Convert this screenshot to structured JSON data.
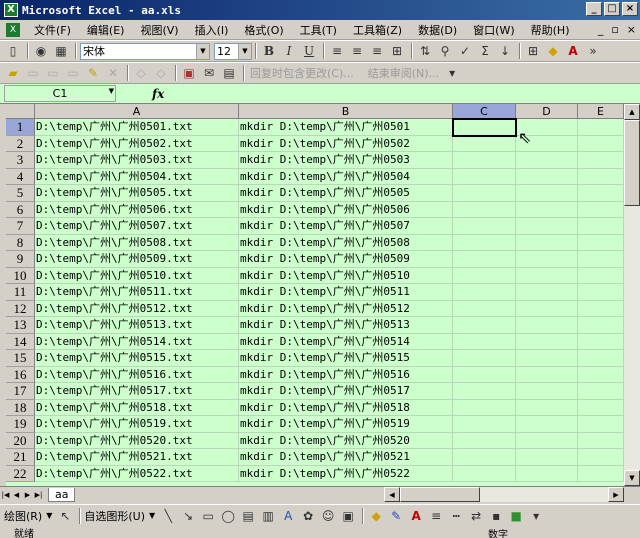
{
  "window": {
    "title": "Microsoft Excel - aa.xls",
    "icon_label": "X",
    "controls": [
      "_",
      "□",
      "×"
    ]
  },
  "menu": {
    "items": [
      "文件(F)",
      "编辑(E)",
      "视图(V)",
      "插入(I)",
      "格式(O)",
      "工具(T)",
      "工具箱(Z)",
      "数据(D)",
      "窗口(W)",
      "帮助(H)"
    ],
    "doc_controls": [
      "_",
      "▫",
      "×"
    ]
  },
  "format_toolbar": {
    "font_name": "宋体",
    "font_size": "12",
    "bold": "B",
    "italic": "I",
    "underline": "U"
  },
  "review_toolbar": {
    "reply_label": "回复时包含更改(C)...",
    "end_review_label": "结束审阅(N)..."
  },
  "formula_bar": {
    "name_box": "C1",
    "fx": "fx",
    "content": ""
  },
  "grid": {
    "columns": [
      "A",
      "B",
      "C",
      "D",
      "E"
    ],
    "active_column": "C",
    "active_cell": "C1",
    "rows": [
      {
        "n": "1",
        "a": "D:\\temp\\广州\\广州0501.txt",
        "b": "mkdir D:\\temp\\广州\\广州0501"
      },
      {
        "n": "2",
        "a": "D:\\temp\\广州\\广州0502.txt",
        "b": "mkdir D:\\temp\\广州\\广州0502"
      },
      {
        "n": "3",
        "a": "D:\\temp\\广州\\广州0503.txt",
        "b": "mkdir D:\\temp\\广州\\广州0503"
      },
      {
        "n": "4",
        "a": "D:\\temp\\广州\\广州0504.txt",
        "b": "mkdir D:\\temp\\广州\\广州0504"
      },
      {
        "n": "5",
        "a": "D:\\temp\\广州\\广州0505.txt",
        "b": "mkdir D:\\temp\\广州\\广州0505"
      },
      {
        "n": "6",
        "a": "D:\\temp\\广州\\广州0506.txt",
        "b": "mkdir D:\\temp\\广州\\广州0506"
      },
      {
        "n": "7",
        "a": "D:\\temp\\广州\\广州0507.txt",
        "b": "mkdir D:\\temp\\广州\\广州0507"
      },
      {
        "n": "8",
        "a": "D:\\temp\\广州\\广州0508.txt",
        "b": "mkdir D:\\temp\\广州\\广州0508"
      },
      {
        "n": "9",
        "a": "D:\\temp\\广州\\广州0509.txt",
        "b": "mkdir D:\\temp\\广州\\广州0509"
      },
      {
        "n": "10",
        "a": "D:\\temp\\广州\\广州0510.txt",
        "b": "mkdir D:\\temp\\广州\\广州0510"
      },
      {
        "n": "11",
        "a": "D:\\temp\\广州\\广州0511.txt",
        "b": "mkdir D:\\temp\\广州\\广州0511"
      },
      {
        "n": "12",
        "a": "D:\\temp\\广州\\广州0512.txt",
        "b": "mkdir D:\\temp\\广州\\广州0512"
      },
      {
        "n": "13",
        "a": "D:\\temp\\广州\\广州0513.txt",
        "b": "mkdir D:\\temp\\广州\\广州0513"
      },
      {
        "n": "14",
        "a": "D:\\temp\\广州\\广州0514.txt",
        "b": "mkdir D:\\temp\\广州\\广州0514"
      },
      {
        "n": "15",
        "a": "D:\\temp\\广州\\广州0515.txt",
        "b": "mkdir D:\\temp\\广州\\广州0515"
      },
      {
        "n": "16",
        "a": "D:\\temp\\广州\\广州0516.txt",
        "b": "mkdir D:\\temp\\广州\\广州0516"
      },
      {
        "n": "17",
        "a": "D:\\temp\\广州\\广州0517.txt",
        "b": "mkdir D:\\temp\\广州\\广州0517"
      },
      {
        "n": "18",
        "a": "D:\\temp\\广州\\广州0518.txt",
        "b": "mkdir D:\\temp\\广州\\广州0518"
      },
      {
        "n": "19",
        "a": "D:\\temp\\广州\\广州0519.txt",
        "b": "mkdir D:\\temp\\广州\\广州0519"
      },
      {
        "n": "20",
        "a": "D:\\temp\\广州\\广州0520.txt",
        "b": "mkdir D:\\temp\\广州\\广州0520"
      },
      {
        "n": "21",
        "a": "D:\\temp\\广州\\广州0521.txt",
        "b": "mkdir D:\\temp\\广州\\广州0521"
      },
      {
        "n": "22",
        "a": "D:\\temp\\广州\\广州0522.txt",
        "b": "mkdir D:\\temp\\广州\\广州0522"
      }
    ]
  },
  "sheet_tabs": [
    "aa"
  ],
  "draw_toolbar": {
    "draw_label": "绘图(R)",
    "autoshapes_label": "自选图形(U)"
  },
  "status": {
    "left": "就绪",
    "right": "数字"
  },
  "colors": {
    "cell_bg": "#ccffcc",
    "title_bar": "#0a246a",
    "active_header": "#9aa6d8"
  }
}
